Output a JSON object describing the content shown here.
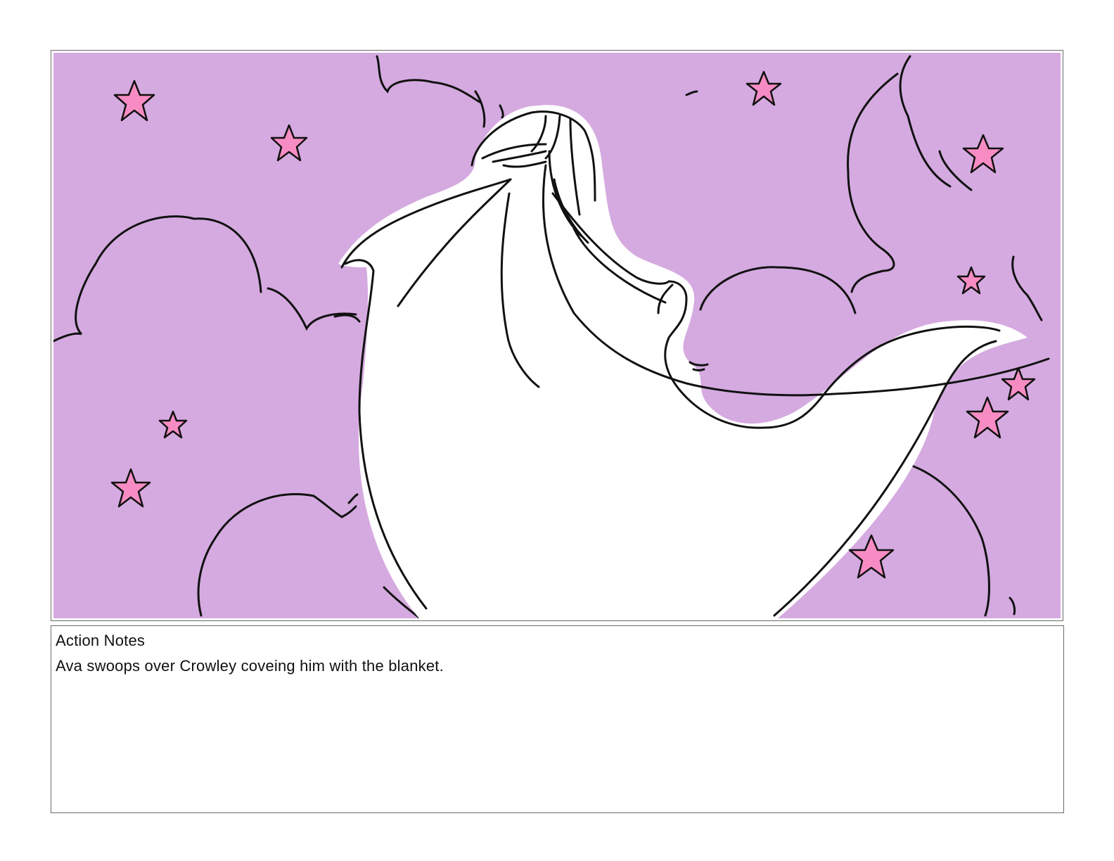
{
  "panel": {
    "sky_color": "#d5aae0",
    "star_color": "#f78cc4",
    "line_color": "#111111",
    "blanket_color": "#ffffff"
  },
  "notes": {
    "heading": "Action Notes",
    "text": "Ava swoops over Crowley coveing him with the blanket."
  }
}
